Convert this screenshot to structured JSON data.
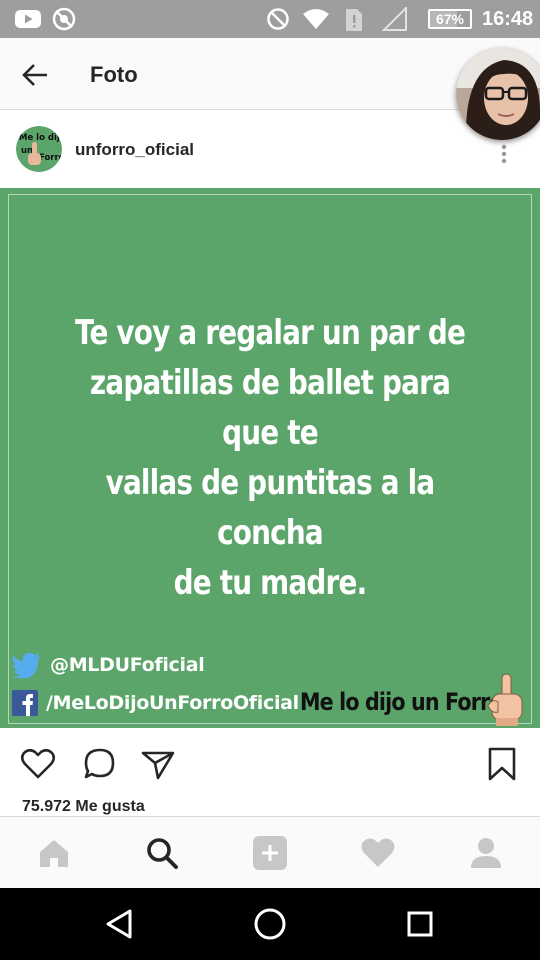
{
  "status_bar": {
    "icons": [
      "youtube-icon",
      "no-camera-icon",
      "do-not-disturb-icon",
      "wifi-icon",
      "sim-alert-icon",
      "signal-icon"
    ],
    "battery": "67%",
    "battery_level": 0.67,
    "time": "16:48"
  },
  "header": {
    "title": "Foto",
    "back_icon": "arrow-left-icon"
  },
  "post": {
    "username": "unforro_oficial",
    "avatar_text": [
      "Me lo dijo",
      "un",
      "Forro"
    ],
    "more_icon": "vertical-dots-icon",
    "image": {
      "background": "#5ba46a",
      "quote_lines": [
        "Te voy a regalar un par de",
        "zapatillas de ballet para que te",
        "vallas de puntitas a la concha",
        "de tu madre."
      ],
      "twitter": "@MLDUFoficial",
      "facebook": "/MeLoDijoUnForroOficial",
      "brand": "Me lo dijo un Forro"
    },
    "likes": "75.972 Me gusta"
  },
  "actions": [
    "heart-icon",
    "comment-icon",
    "share-icon",
    "bookmark-icon"
  ],
  "tabs": [
    "home-icon",
    "search-icon",
    "add-icon",
    "activity-heart-icon",
    "profile-icon"
  ],
  "nav": [
    "back-triangle-icon",
    "home-circle-icon",
    "recents-square-icon"
  ]
}
